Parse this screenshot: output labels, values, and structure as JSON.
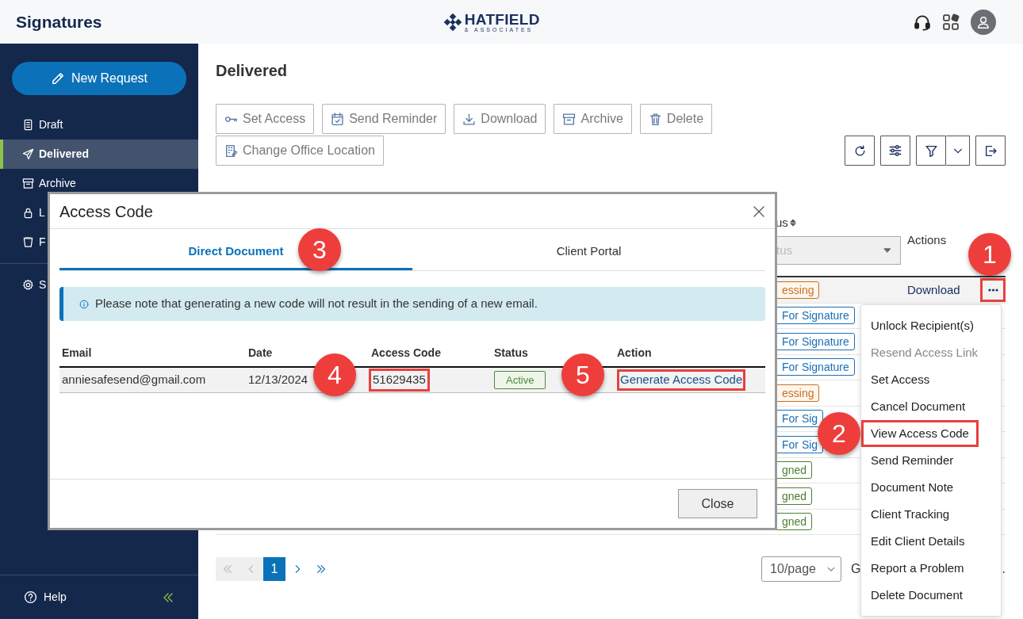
{
  "app": {
    "title": "Signatures",
    "logo": {
      "name": "HATFIELD",
      "tagline": "& ASSOCIATES"
    }
  },
  "sidebar": {
    "new_request": "New Request",
    "items": [
      {
        "label": "Draft",
        "kind": "draft",
        "selected": false
      },
      {
        "label": "Delivered",
        "kind": "send",
        "selected": true
      },
      {
        "label": "Archive",
        "kind": "archive",
        "selected": false
      },
      {
        "label": "L",
        "kind": "lock",
        "selected": false
      },
      {
        "label": "F",
        "kind": "bin",
        "selected": false
      }
    ],
    "settings": {
      "label": "S"
    },
    "help": "Help"
  },
  "page": {
    "title": "Delivered",
    "toolbar": [
      [
        {
          "label": "Set Access",
          "kind": "key"
        },
        {
          "label": "Send Reminder",
          "kind": "calendar"
        },
        {
          "label": "Download",
          "kind": "download"
        },
        {
          "label": "Archive",
          "kind": "archive"
        },
        {
          "label": "Delete",
          "kind": "trash"
        }
      ],
      [
        {
          "label": "Change Office Location",
          "kind": "building"
        }
      ]
    ]
  },
  "table": {
    "status_header": "us",
    "actions_header": "Actions",
    "status_filter": {
      "placeholder": "tus"
    },
    "rows": [
      {
        "status": "essing",
        "kind": "processing",
        "action": "Download",
        "highlighted": true
      },
      {
        "status": "For Signature",
        "kind": "waiting"
      },
      {
        "status": "For Signature",
        "kind": "waiting"
      },
      {
        "status": "For Signature",
        "kind": "waiting"
      },
      {
        "status": "essing",
        "kind": "processing"
      },
      {
        "status": "For Sig",
        "kind": "waiting"
      },
      {
        "status": "For Sig",
        "kind": "waiting"
      },
      {
        "status": "gned",
        "kind": "signed"
      },
      {
        "status": "gned",
        "kind": "signed"
      },
      {
        "status": "gned",
        "kind": "signed"
      }
    ]
  },
  "pagination": {
    "nav": [
      {
        "kind": "first",
        "disabled": true
      },
      {
        "kind": "prev",
        "disabled": true
      },
      {
        "kind": "next",
        "disabled": false
      },
      {
        "kind": "last",
        "disabled": false
      }
    ],
    "pages": [
      {
        "label": "1",
        "selected": true
      }
    ],
    "page_size": "10/page",
    "trailing_text": "G",
    "edge_text": "."
  },
  "modal": {
    "title": "Access Code",
    "tabs": [
      {
        "label": "Direct Document",
        "selected": true
      },
      {
        "label": "Client Portal",
        "selected": false
      }
    ],
    "notice": "Please note that generating a new code will not result in the sending of a new email.",
    "columns": [
      "Email",
      "Date",
      "Access Code",
      "Status",
      "Action"
    ],
    "rows": [
      {
        "email": "anniesafesend@gmail.com",
        "date": "12/13/2024",
        "access_code": "51629435",
        "code_highlighted": true,
        "status": "Active",
        "action": "Generate Access Code",
        "action_highlighted": true
      }
    ],
    "close": "Close"
  },
  "menu": {
    "items": [
      {
        "label": "Unlock Recipient(s)",
        "disabled": false,
        "highlighted": false
      },
      {
        "label": "Resend Access Link",
        "disabled": true,
        "highlighted": false
      },
      {
        "label": "Set Access",
        "disabled": false,
        "highlighted": false
      },
      {
        "label": "Cancel Document",
        "disabled": false,
        "highlighted": false
      },
      {
        "label": "View Access Code",
        "disabled": false,
        "highlighted": true
      },
      {
        "label": "Send Reminder",
        "disabled": false,
        "highlighted": false
      },
      {
        "label": "Document Note",
        "disabled": false,
        "highlighted": false
      },
      {
        "label": "Client Tracking",
        "disabled": false,
        "highlighted": false
      },
      {
        "label": "Edit Client Details",
        "disabled": false,
        "highlighted": false
      },
      {
        "label": "Report a Problem",
        "disabled": false,
        "highlighted": false
      },
      {
        "label": "Delete Document",
        "disabled": false,
        "highlighted": false
      }
    ]
  },
  "callouts": [
    {
      "number": "1"
    },
    {
      "number": "2"
    },
    {
      "number": "3"
    },
    {
      "number": "4"
    },
    {
      "number": "5"
    }
  ]
}
